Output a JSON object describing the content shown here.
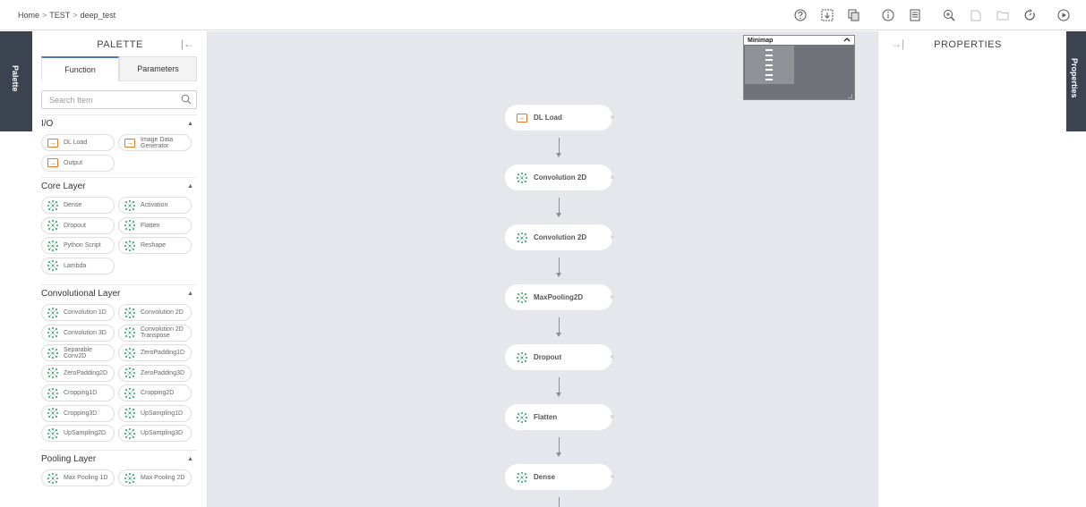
{
  "breadcrumb": [
    "Home",
    "TEST",
    "deep_test"
  ],
  "toolbar": [
    {
      "name": "help-icon",
      "disabled": false
    },
    {
      "name": "import-icon",
      "disabled": false
    },
    {
      "name": "copy-icon",
      "disabled": false
    },
    {
      "name": "info-icon",
      "disabled": false
    },
    {
      "name": "document-icon",
      "disabled": false
    },
    {
      "name": "zoom-in-icon",
      "disabled": false
    },
    {
      "name": "new-file-icon",
      "disabled": true
    },
    {
      "name": "folder-icon",
      "disabled": true
    },
    {
      "name": "refresh-icon",
      "disabled": false
    },
    {
      "name": "play-icon",
      "disabled": false
    }
  ],
  "left_tab": "Palette",
  "right_tab": "Properties",
  "palette": {
    "title": "PALETTE",
    "tabs": [
      "Function",
      "Parameters"
    ],
    "active_tab": "Function",
    "search_placeholder": "Search Item",
    "sections": [
      {
        "title": "I/O",
        "icon": "io",
        "items": [
          "DL Load",
          "Image Data Generator",
          "Output"
        ]
      },
      {
        "title": "Core Layer",
        "icon": "layer",
        "items": [
          "Dense",
          "Activation",
          "Dropout",
          "Flatten",
          "Python Script",
          "Reshape",
          "Lambda"
        ]
      },
      {
        "title": "Convolutional Layer",
        "icon": "layer",
        "items": [
          "Convolution 1D",
          "Convolution 2D",
          "Convolution 3D",
          "Convolution 2D Transpose",
          "Separable Conv2D",
          "ZeroPadding1D",
          "ZeroPadding2D",
          "ZeroPadding3D",
          "Cropping1D",
          "Cropping2D",
          "Cropping3D",
          "UpSampling1D",
          "UpSampling2D",
          "UpSampling3D"
        ]
      },
      {
        "title": "Pooling Layer",
        "icon": "layer",
        "items": [
          "Max Pooling 1D",
          "Max Pooling 2D"
        ]
      }
    ]
  },
  "canvas": {
    "nodes": [
      {
        "label": "DL Load",
        "icon": "io"
      },
      {
        "label": "Convolution 2D",
        "icon": "layer"
      },
      {
        "label": "Convolution 2D",
        "icon": "layer"
      },
      {
        "label": "MaxPooling2D",
        "icon": "layer"
      },
      {
        "label": "Dropout",
        "icon": "layer"
      },
      {
        "label": "Flatten",
        "icon": "layer"
      },
      {
        "label": "Dense",
        "icon": "layer"
      }
    ],
    "minimap_title": "Minimap"
  },
  "properties": {
    "title": "PROPERTIES"
  },
  "colors": {
    "io_icon": "#e07a2e",
    "layer_icon": "#4caf7d",
    "sidebar_tab": "#3c4350",
    "canvas_bg": "#e5e7ec",
    "active_tab": "#4e73c7"
  }
}
